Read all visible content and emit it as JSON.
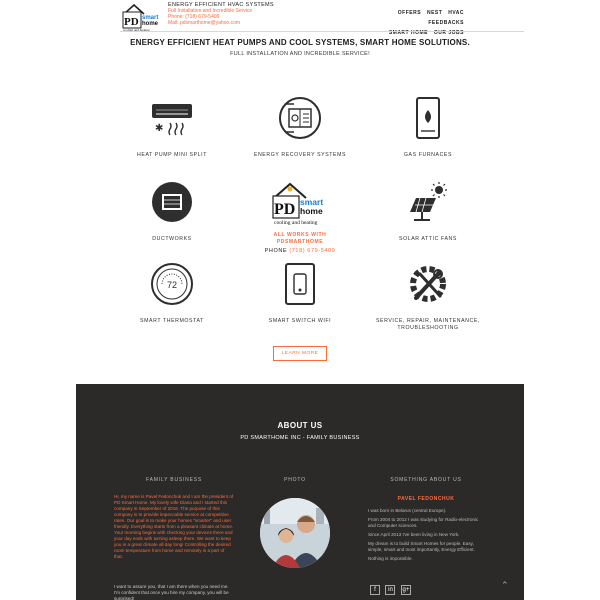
{
  "header": {
    "logo_text": "PD smart home",
    "logo_sub": "cooling and heating",
    "company": "ENERGY EFFICIENT HVAC SYSTEMS",
    "tagline": "Full Installation and Incredible Service",
    "phone": "Phone: (718) 679-5409",
    "mail": "Mail: pdsmarthome@yahoo.com",
    "nav": [
      "OFFERS",
      "NEST",
      "HVAC",
      "FEEDBACKS",
      "SMART HOME",
      "OUR JOBS"
    ]
  },
  "hero": {
    "title": "ENERGY EFFICIENT HEAT PUMPS AND COOL SYSTEMS, SMART HOME SOLUTIONS.",
    "subtitle": "FULL INSTALLATION AND INCREDIBLE SERVICE!"
  },
  "services": [
    {
      "label": "HEAT PUMP MINI SPLIT",
      "icon": "ac-unit-icon"
    },
    {
      "label": "ENERGY RECOVERY SYSTEMS",
      "icon": "erv-icon"
    },
    {
      "label": "GAS FURNACES",
      "icon": "furnace-icon"
    },
    {
      "label": "DUCTWORKS",
      "icon": "duct-icon"
    },
    {
      "label": "SOLAR ATTIC FANS",
      "icon": "solar-panel-icon"
    },
    {
      "label": "SMART THERMOSTAT",
      "icon": "thermostat-icon"
    },
    {
      "label": "SMART SWITCH WIFI",
      "icon": "smart-switch-icon"
    },
    {
      "label": "SERVICE, REPAIR, MAINTENANCE, TROUBLESHOOTING",
      "icon": "wrench-gear-icon"
    }
  ],
  "center": {
    "works_line1": "ALL WORKS WITH",
    "works_line2": "PDSMARTHOME",
    "phone_label": "PHONE",
    "phone_number": "(718) 679-5409"
  },
  "learn_more": "LEARN MORE",
  "about": {
    "title": "ABOUT US",
    "subtitle": "PD SMARTHOME INC - FAMILY BUSINESS",
    "col_family": "FAMILY BUSINESS",
    "col_photo": "PHOTO",
    "col_some": "SOMETHING ABOUT US",
    "family_text": "Hi, my name is Pavel Fedonchuk and I am the president of PD Smart Home. My lovely wife Diana and I started this company in September of 2016. The purpose of this company is to provide impeccable service at competitive rates. Our goal is to make your homes \"smarter\" and user friendly. Everything starts from a pleasant climate at home. Your morning begins with checking your devices there and your day ends with turning asleep there. We want to keep you in a great climate all day long! Controlling the desired room temperature from home and remotely is a part of that.",
    "family_text2": "I want to assure you, that I am there when you need me. I'm confident that once you hire my company, you will be surprised!",
    "name": "PAVEL FEDONCHUK",
    "some_lines": [
      "I was born in Belarus (central Europe).",
      "From 2004 to 2012 I was studying for Radio-electronic and Computer sciences.",
      "Since April 2013 I've been living in New York.",
      "My dream is to build Smart Homes for people. Easy, simple, smart and most importantly, Energy Efficient.",
      "Nothing is impossible."
    ],
    "social": [
      "f",
      "in",
      "g+"
    ]
  },
  "colors": {
    "accent": "#ff6a3d",
    "dark": "#2b2a29"
  }
}
